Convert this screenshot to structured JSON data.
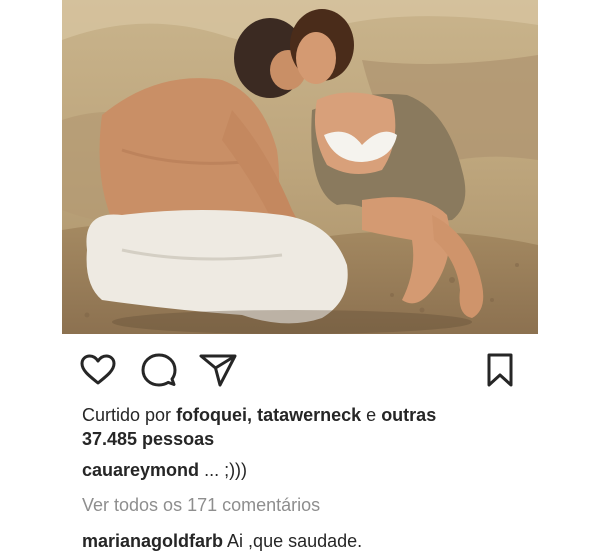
{
  "post": {
    "image_alt": "couple kissing on rocky beach"
  },
  "actions": {
    "like_icon": "heart-icon",
    "comment_icon": "comment-bubble-icon",
    "share_icon": "paper-plane-icon",
    "save_icon": "bookmark-icon"
  },
  "likes": {
    "prefix": "Curtido por",
    "user1": "fofoquei",
    "separator": ",",
    "user2": "tatawerneck",
    "conjunction": "e",
    "others_label": "outras",
    "count_text": "37.485 pessoas"
  },
  "caption": {
    "username": "cauareymond",
    "text": "... ;)))"
  },
  "comments": {
    "view_all": "Ver todos os 171 comentários",
    "items": [
      {
        "username": "marianagoldfarb",
        "text": "Ai ,que saudade."
      }
    ]
  },
  "colors": {
    "text": "#262626",
    "muted": "#8e8e8e",
    "background": "#ffffff"
  }
}
